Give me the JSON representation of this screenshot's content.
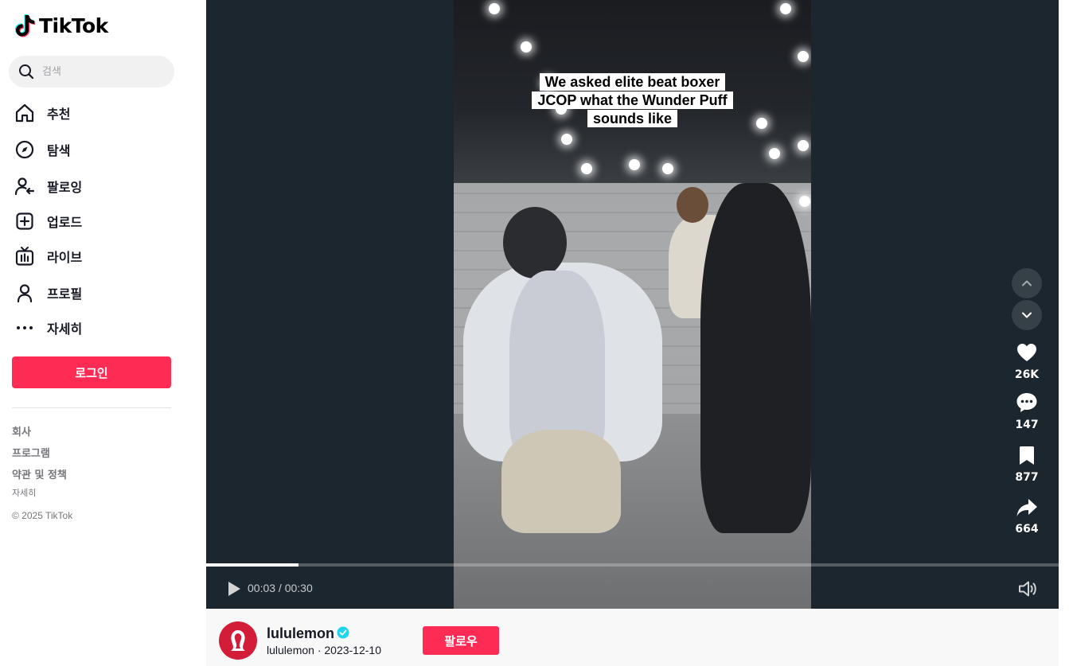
{
  "app": {
    "name": "TikTok",
    "brand_color": "#fe2c55"
  },
  "search": {
    "placeholder": "검색"
  },
  "nav": [
    {
      "label": "추천",
      "icon": "home-icon"
    },
    {
      "label": "탐색",
      "icon": "compass-icon"
    },
    {
      "label": "팔로잉",
      "icon": "following-icon"
    },
    {
      "label": "업로드",
      "icon": "upload-icon"
    },
    {
      "label": "라이브",
      "icon": "live-icon"
    },
    {
      "label": "프로필",
      "icon": "profile-icon"
    },
    {
      "label": "자세히",
      "icon": "more-icon"
    }
  ],
  "login_label": "로그인",
  "footer": {
    "company": "회사",
    "program": "프로그램",
    "terms": "약관 및 정책",
    "more": "자세히",
    "copyright": "© 2025 TikTok"
  },
  "video": {
    "caption_lines": [
      "We asked elite beat boxer",
      "JCOP what the Wunder Puff",
      "sounds like"
    ],
    "time": "00:03 / 00:30",
    "progress": 0.108
  },
  "actions": {
    "likes": "26K",
    "comments": "147",
    "saves": "877",
    "shares": "664"
  },
  "creator": {
    "name": "lululemon",
    "meta": "lululemon · 2023-12-10",
    "follow_label": "팔로우"
  }
}
